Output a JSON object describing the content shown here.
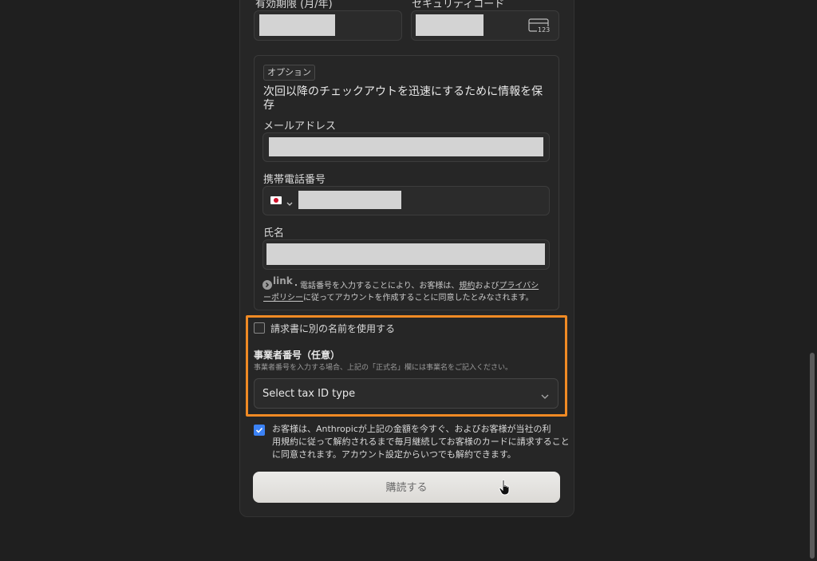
{
  "card": {
    "expiry_label": "有効期限 (月/年)",
    "cvc_label": "セキュリティコード",
    "cvc_icon_text": "123"
  },
  "options": {
    "badge": "オプション",
    "heading_line1": "次回以降のチェックアウトを迅速にするために情報を保",
    "heading_line2": "存",
    "email_label": "メールアドレス",
    "phone_label": "携帯電話番号",
    "name_label": "氏名",
    "link_brand": "link",
    "legal_prefix": "・電話番号を入力することにより、お客様は、",
    "legal_terms": "規約",
    "legal_and": "および",
    "legal_privacy1": "プライバシ",
    "legal_privacy2": "ーポリシー",
    "legal_suffix": "に従ってアカウントを作成することに同意したとみなされます。"
  },
  "billing": {
    "alt_name_label": "請求書に別の名前を使用する",
    "tax_title": "事業者番号（任意）",
    "tax_hint": "事業者番号を入力する場合、上記の「正式名」欄には事業名をご記入ください。",
    "tax_select_placeholder": "Select tax ID type"
  },
  "consent": {
    "line1": "お客様は、Anthropicが上記の金額を今すぐ、およびお客様が当社の利",
    "line2": "用規約に従って解約されるまで毎月継続してお客様のカードに請求すること",
    "line3": "に同意されます。アカウント設定からいつでも解約できます。",
    "checked": true
  },
  "submit_label": "購読する",
  "colors": {
    "background": "#1f1f1f",
    "highlight": "#f08a24",
    "checkbox_checked": "#3b82f6",
    "button": "#e6e4e1"
  }
}
